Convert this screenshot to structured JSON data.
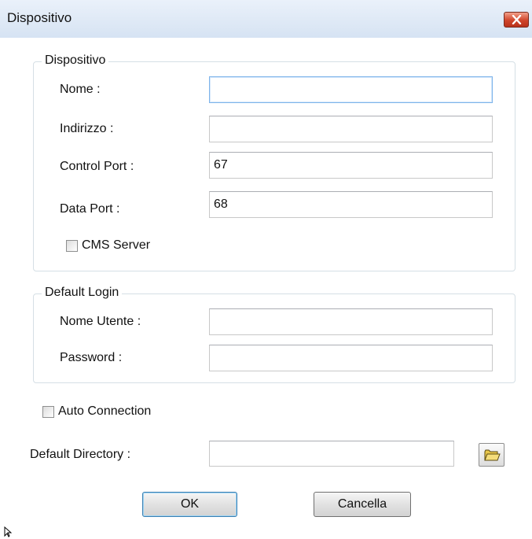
{
  "window": {
    "title": "Dispositivo",
    "close_icon": "close-icon"
  },
  "device_group": {
    "legend": "Dispositivo",
    "name_label": "Nome :",
    "name_value": "",
    "address_label": "Indirizzo :",
    "address_value": "",
    "control_port_label": "Control Port :",
    "control_port_value": "67",
    "data_port_label": "Data Port :",
    "data_port_value": "68",
    "cms_server_label": "CMS Server",
    "cms_server_checked": false
  },
  "login_group": {
    "legend": "Default Login",
    "username_label": "Nome Utente :",
    "username_value": "",
    "password_label": "Password :",
    "password_value": ""
  },
  "auto_connection": {
    "label": "Auto Connection",
    "checked": false
  },
  "default_directory": {
    "label": "Default Directory :",
    "value": "",
    "browse_icon": "folder-icon"
  },
  "buttons": {
    "ok_label": "OK",
    "cancel_label": "Cancella"
  },
  "colors": {
    "accent_focus": "#7eb4ea",
    "close_red": "#d0452b",
    "titlebar": "#d6e3f3"
  }
}
